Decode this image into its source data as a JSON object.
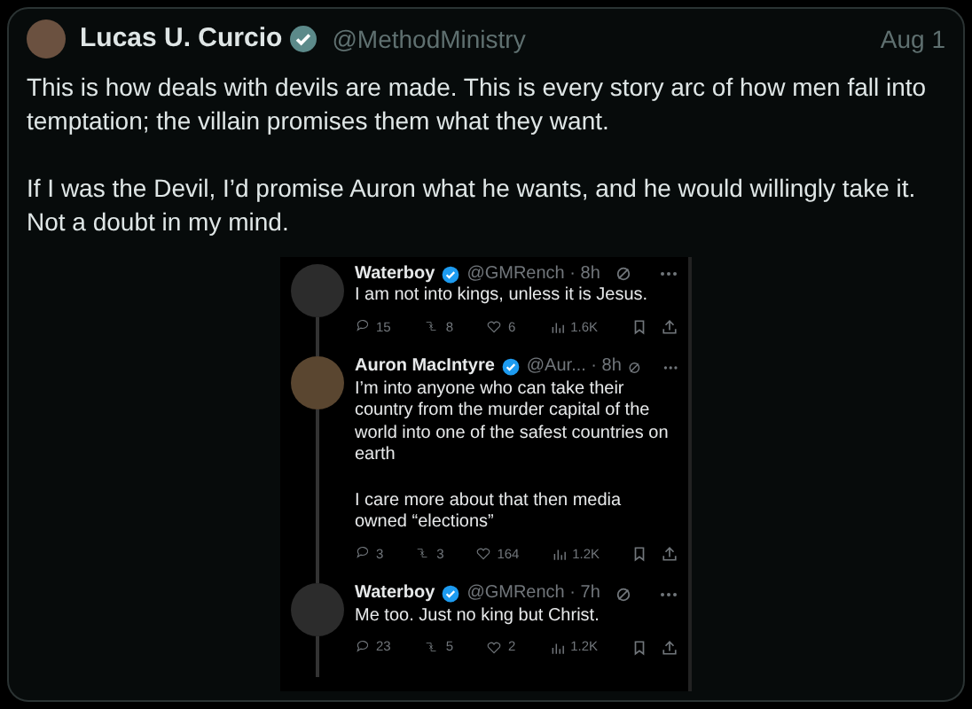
{
  "post": {
    "author": {
      "name": "Lucas U. Curcio",
      "verified": true,
      "handle": "@MethodMinistry"
    },
    "date": "Aug 1",
    "paragraphs": [
      "This is how deals with devils are made. This is every story arc of how men fall into temptation; the villain promises them what they want.",
      "If I was the Devil, I’d promise Auron what he wants, and he would willingly take it. Not a doubt in my mind."
    ],
    "screenshot": {
      "tweets": [
        {
          "name": "Waterboy",
          "verified": true,
          "meta": "@GMRench · 8h",
          "text": [
            "I am not into kings, unless it is Jesus."
          ],
          "stats": [
            "15",
            "8",
            "6",
            "1.6K"
          ]
        },
        {
          "name": "Auron MacIntyre",
          "verified": true,
          "meta": "@Aur... · 8h",
          "text": [
            "I’m into anyone who can take their country from the murder capital of the world into one of the safest countries on earth",
            "I care more about that then media owned “elections”"
          ],
          "stats": [
            "3",
            "3",
            "164",
            "1.2K"
          ]
        },
        {
          "name": "Waterboy",
          "verified": true,
          "meta": "@GMRench · 7h",
          "text": [
            "Me too. Just no king but Christ."
          ],
          "stats": [
            "23",
            "5",
            "2",
            "1.2K"
          ]
        }
      ]
    }
  }
}
